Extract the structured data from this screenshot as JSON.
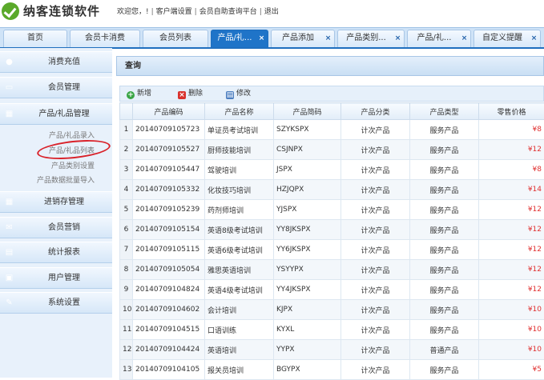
{
  "app": {
    "title": "纳客连锁软件"
  },
  "topnav": {
    "welcome": "欢迎您，!",
    "client_settings": "客户端设置",
    "member_portal": "会员自助查询平台",
    "logout": "退出"
  },
  "tabs": [
    {
      "label": "首页",
      "closable": false,
      "active": false
    },
    {
      "label": "会员卡消费",
      "closable": false,
      "active": false
    },
    {
      "label": "会员列表",
      "closable": false,
      "active": false
    },
    {
      "label": "产品/礼...",
      "closable": true,
      "active": true
    },
    {
      "label": "产品添加",
      "closable": true,
      "active": false
    },
    {
      "label": "产品类别...",
      "closable": true,
      "active": false
    },
    {
      "label": "产品/礼...",
      "closable": true,
      "active": false
    },
    {
      "label": "自定义提醒",
      "closable": true,
      "active": false
    }
  ],
  "sidebar": {
    "sections": [
      {
        "label": "消费充值",
        "icon": "user-icon"
      },
      {
        "label": "会员管理",
        "icon": "card-icon"
      },
      {
        "label": "产品/礼品管理",
        "icon": "gift-icon"
      },
      {
        "label": "进销存管理",
        "icon": "stock-icon"
      },
      {
        "label": "会员营销",
        "icon": "mail-icon"
      },
      {
        "label": "统计报表",
        "icon": "report-icon"
      },
      {
        "label": "用户管理",
        "icon": "lock-icon"
      },
      {
        "label": "系统设置",
        "icon": "wrench-icon"
      }
    ],
    "sub_items": [
      "产品/礼品录入",
      "产品/礼品列表",
      "产品类别设置",
      "产品数据批量导入"
    ]
  },
  "panel": {
    "title": "查询"
  },
  "toolbar": {
    "add": "新增",
    "delete": "删除",
    "edit": "修改"
  },
  "table": {
    "columns": [
      "",
      "产品编码",
      "产品名称",
      "产品简码",
      "产品分类",
      "产品类型",
      "零售价格"
    ],
    "rows": [
      [
        "1",
        "20140709105723",
        "单证员考试培训",
        "SZYKSPX",
        "计次产品",
        "服务产品",
        "¥8"
      ],
      [
        "2",
        "20140709105527",
        "厨师技能培训",
        "CSJNPX",
        "计次产品",
        "服务产品",
        "¥12"
      ],
      [
        "3",
        "20140709105447",
        "驾驶培训",
        "JSPX",
        "计次产品",
        "服务产品",
        "¥8"
      ],
      [
        "4",
        "20140709105332",
        "化妆技巧培训",
        "HZJQPX",
        "计次产品",
        "服务产品",
        "¥14"
      ],
      [
        "5",
        "20140709105239",
        "药剂师培训",
        "YJSPX",
        "计次产品",
        "服务产品",
        "¥12"
      ],
      [
        "6",
        "20140709105154",
        "英语8级考试培训",
        "YY8JKSPX",
        "计次产品",
        "服务产品",
        "¥12"
      ],
      [
        "7",
        "20140709105115",
        "英语6级考试培训",
        "YY6JKSPX",
        "计次产品",
        "服务产品",
        "¥12"
      ],
      [
        "8",
        "20140709105054",
        "雅思英语培训",
        "YSYYPX",
        "计次产品",
        "服务产品",
        "¥12"
      ],
      [
        "9",
        "20140709104824",
        "英语4级考试培训",
        "YY4JKSPX",
        "计次产品",
        "服务产品",
        "¥12"
      ],
      [
        "10",
        "20140709104602",
        "会计培训",
        "KJPX",
        "计次产品",
        "服务产品",
        "¥10"
      ],
      [
        "11",
        "20140709104515",
        "口语训练",
        "KYXL",
        "计次产品",
        "服务产品",
        "¥10"
      ],
      [
        "12",
        "20140709104424",
        "英语培训",
        "YYPX",
        "计次产品",
        "普通产品",
        "¥10"
      ],
      [
        "13",
        "20140709104105",
        "报关员培训",
        "BGYPX",
        "计次产品",
        "服务产品",
        "¥5"
      ]
    ]
  }
}
